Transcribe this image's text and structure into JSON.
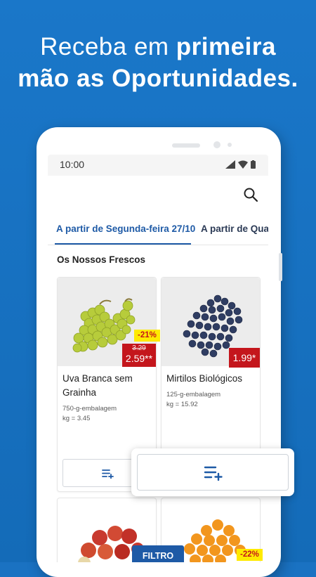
{
  "headline": {
    "line1_normal": "Receba em ",
    "line1_bold": "primeira",
    "line2": "mão as Oportunidades."
  },
  "status_bar": {
    "time": "10:00"
  },
  "tabs": [
    {
      "label": "A partir de Segunda-feira 27/10",
      "active": true
    },
    {
      "label": "A partir de Quar",
      "active": false
    }
  ],
  "section_title": "Os Nossos Frescos",
  "products": [
    {
      "name": "Uva Branca sem Grainha",
      "discount": "-21%",
      "old_price": "3.29",
      "price": "2.59**",
      "meta_line1": "750-g-embalagem",
      "meta_line2": "kg = 3.45",
      "image_icon": "green-grapes-image"
    },
    {
      "name": "Mirtilos Biológicos",
      "price": "1.99*",
      "meta_line1": "125-g-embalagem",
      "meta_line2": "kg = 15.92",
      "image_icon": "blueberries-image"
    },
    {
      "image_icon": "apples-image"
    },
    {
      "discount": "-22%",
      "image_icon": "oranges-image"
    }
  ],
  "filter_label": "FILTRO",
  "colors": {
    "background": "#1a72c2",
    "accent_blue": "#1e5aa6",
    "price_red": "#c4161c",
    "discount_yellow": "#ffea00"
  }
}
